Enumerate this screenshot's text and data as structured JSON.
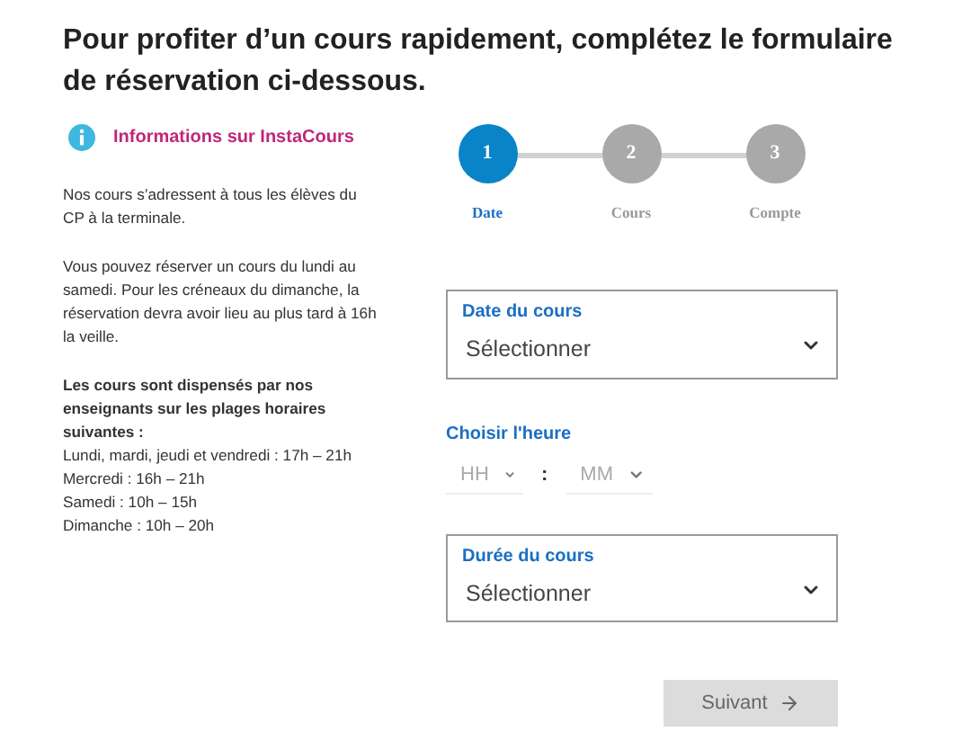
{
  "heading": "Pour profiter d’un cours rapidement, complétez le formulaire de réservation ci-dessous.",
  "info": {
    "title": "Informations sur InstaCours",
    "paragraphs": [
      "Nos cours s’adressent à tous les élèves du CP à la terminale.",
      "Vous pouvez réserver un cours du lundi au samedi. Pour les créneaux du dimanche, la réservation devra avoir lieu au plus tard à 16h la veille."
    ],
    "schedule_title": "Les cours sont dispensés par nos enseignants sur les plages horaires suivantes :",
    "schedule": [
      "Lundi, mardi, jeudi et vendredi : 17h – 21h",
      "Mercredi : 16h – 21h",
      "Samedi : 10h – 15h",
      "Dimanche : 10h – 20h"
    ]
  },
  "steps": [
    {
      "number": "1",
      "label": "Date",
      "selected": true
    },
    {
      "number": "2",
      "label": "Cours",
      "selected": false
    },
    {
      "number": "3",
      "label": "Compte",
      "selected": false
    }
  ],
  "fields": [
    {
      "kind": "select",
      "label": "Date du cours",
      "value": "Sélectionner"
    },
    {
      "kind": "time",
      "label": "Choisir l'heure",
      "hour": "HH",
      "separator": ":",
      "minute": "MM"
    },
    {
      "kind": "select",
      "label": "Durée du cours",
      "value": "Sélectionner"
    }
  ],
  "next_button": "Suivant"
}
